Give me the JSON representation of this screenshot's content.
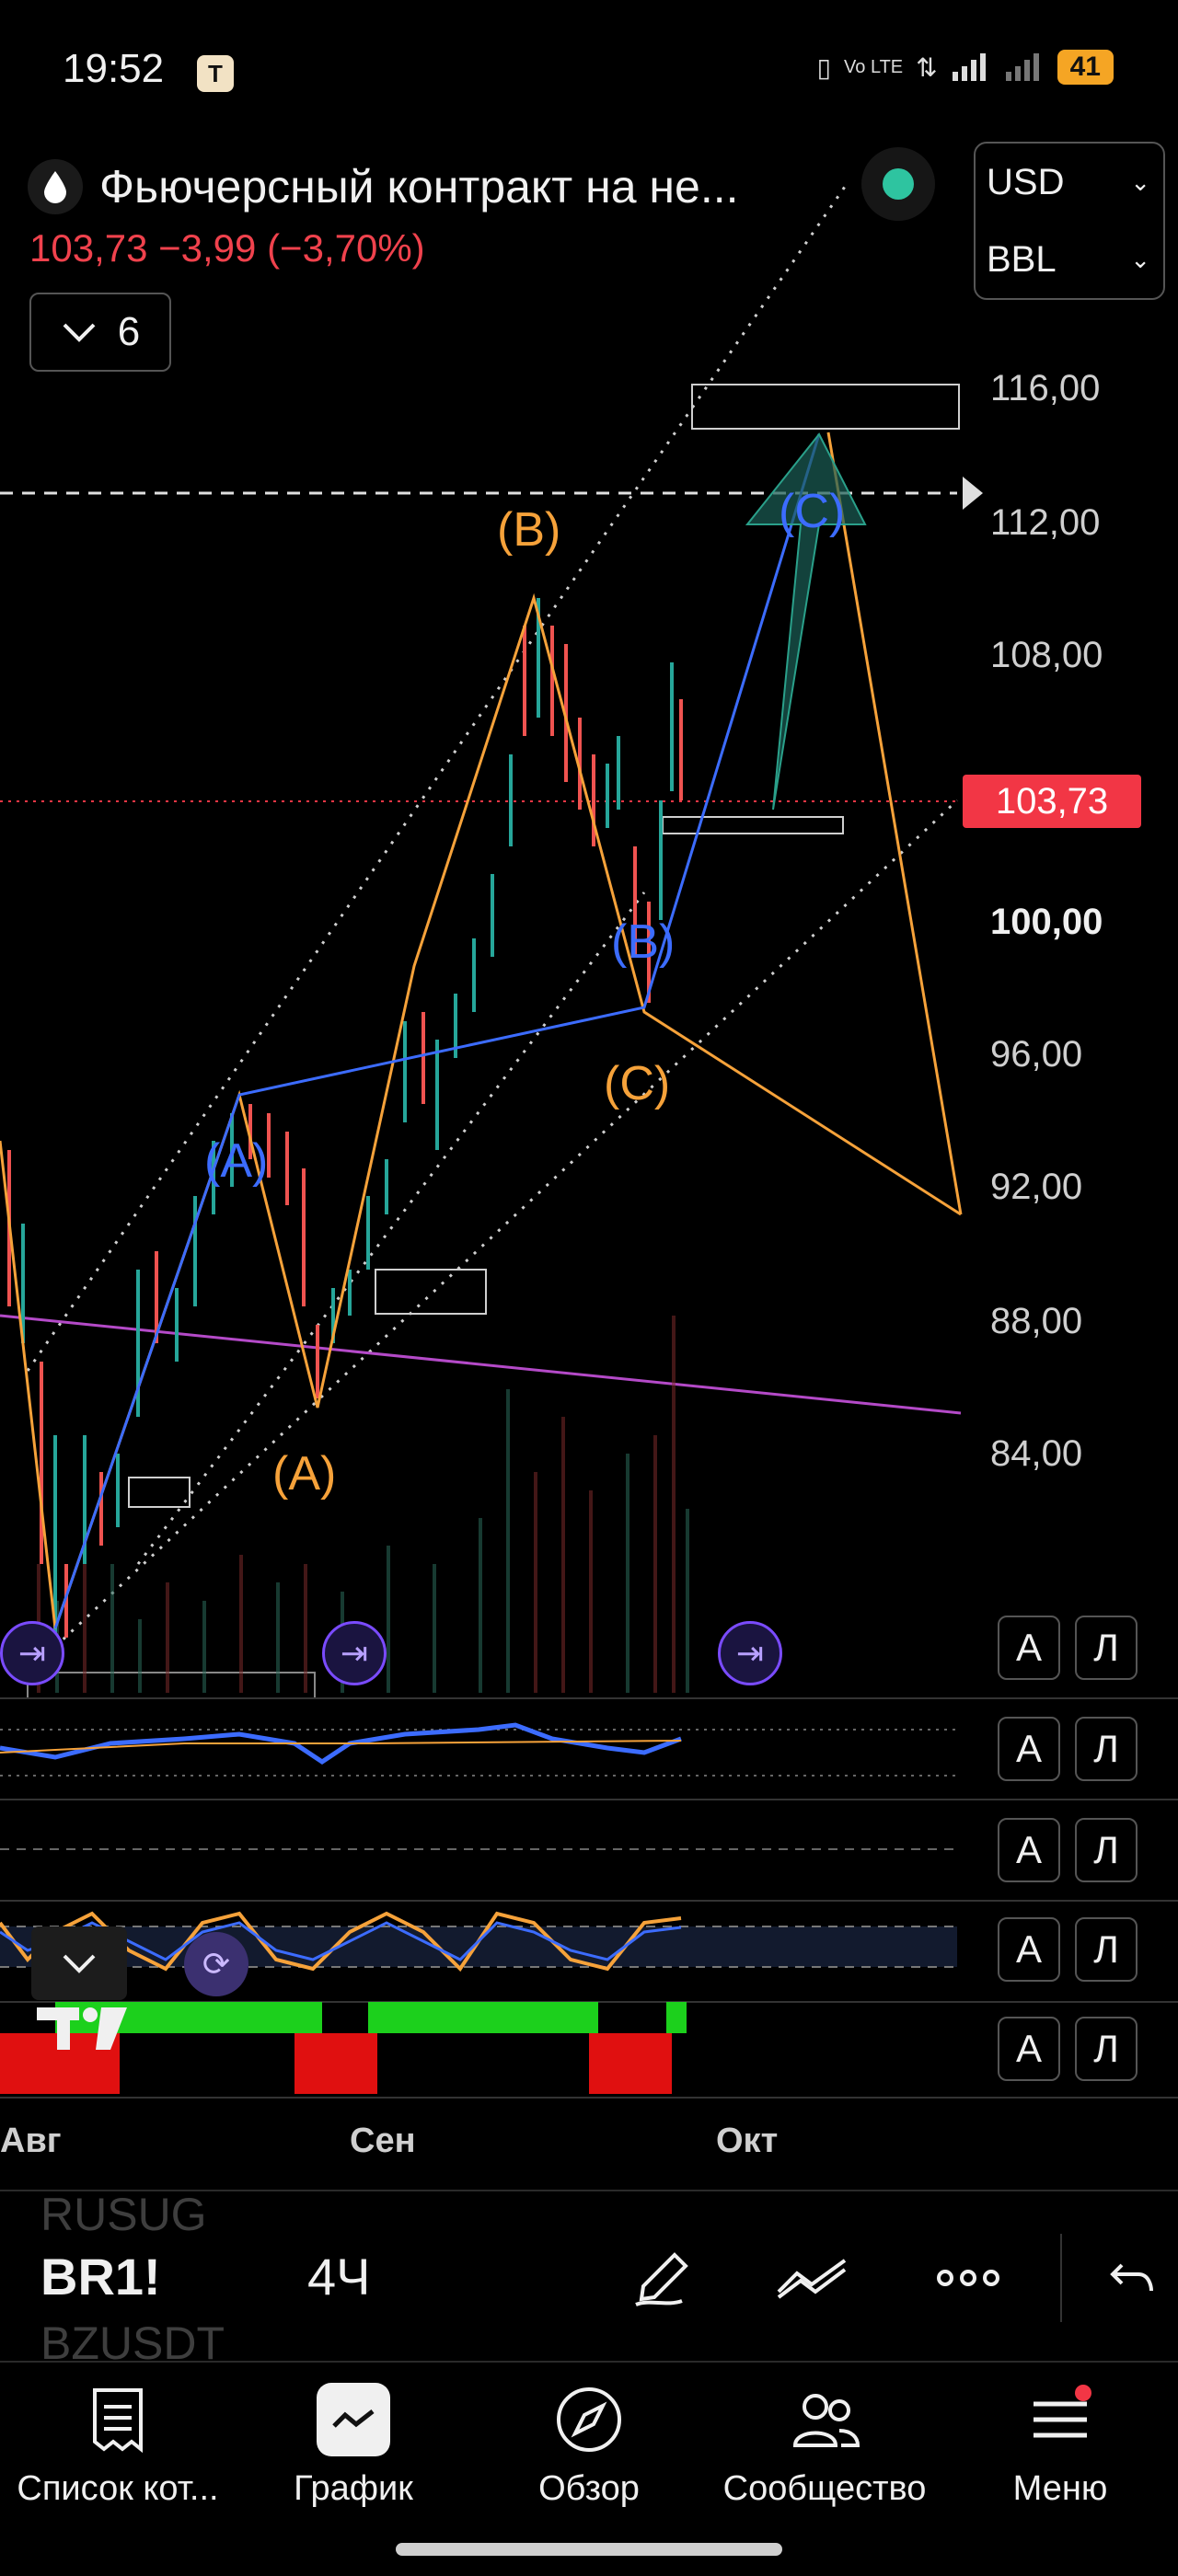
{
  "status_bar": {
    "time": "19:52",
    "app_badge": "T",
    "network": "Vo LTE",
    "battery": "41"
  },
  "header": {
    "symbol_name": "Фьючерсный контракт на не...",
    "price_change": "103,73  −3,99 (−3,70%)",
    "currency": "USD",
    "unit": "BBL",
    "collapse_count": "6"
  },
  "chart": {
    "price_axis": [
      "116,00",
      "112,00",
      "108,00",
      "100,00",
      "96,00",
      "92,00",
      "88,00",
      "84,00"
    ],
    "bold_label": "100,00",
    "last_price": "103,73",
    "months": [
      "Авг",
      "Сен",
      "Окт"
    ],
    "waves_orange": [
      "(B)",
      "(C)",
      "(A)"
    ],
    "waves_blue": [
      "(C)",
      "(B)",
      "(A)"
    ],
    "pane_button_a": "А",
    "pane_button_l": "Л",
    "colors": {
      "up": "#26a69a",
      "down": "#ef5350",
      "wave_orange": "#f6a23a",
      "wave_blue": "#3c6cff",
      "trend": "#b44ac8"
    }
  },
  "toolbar": {
    "symbol": "BR1!",
    "interval": "4Ч",
    "ghost_above": "RUSUG",
    "ghost_below": "BZUSDT"
  },
  "nav": [
    {
      "label": "Список кот..."
    },
    {
      "label": "График"
    },
    {
      "label": "Обзор"
    },
    {
      "label": "Сообщество"
    },
    {
      "label": "Меню"
    }
  ]
}
